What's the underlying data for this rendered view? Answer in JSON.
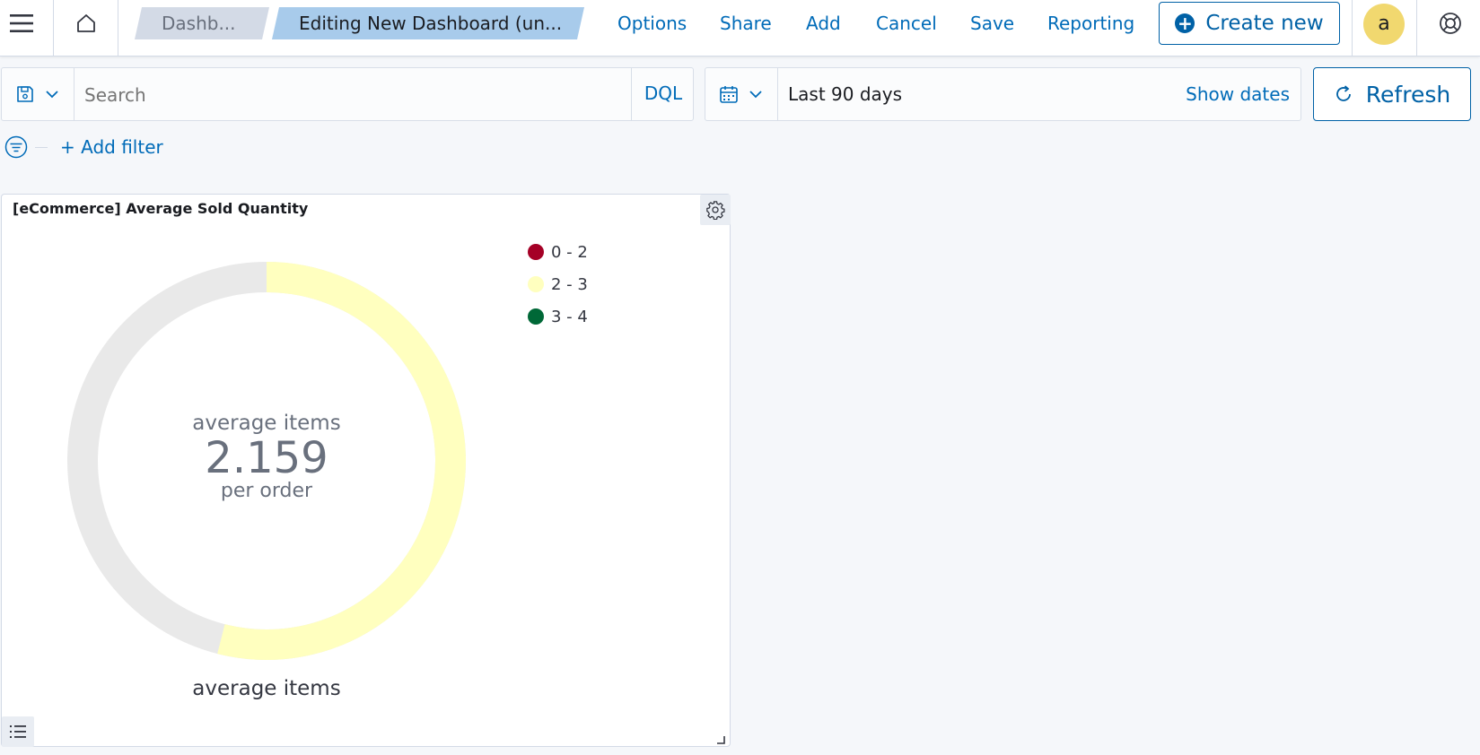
{
  "header": {
    "breadcrumbs": [
      "Dashb...",
      "Editing New Dashboard (un..."
    ],
    "nav": {
      "options": "Options",
      "share": "Share",
      "add": "Add",
      "cancel": "Cancel",
      "save": "Save",
      "reporting": "Reporting"
    },
    "create_new": "Create new",
    "avatar_initial": "a"
  },
  "query": {
    "search_placeholder": "Search",
    "language": "DQL",
    "time_range": "Last 90 days",
    "show_dates": "Show dates",
    "refresh": "Refresh",
    "add_filter": "+ Add filter"
  },
  "panel": {
    "title": "[eCommerce] Average Sold Quantity",
    "gauge_label_top": "average items",
    "gauge_value": "2.159",
    "gauge_label_bottom": "per order",
    "gauge_caption": "average items"
  },
  "chart_data": {
    "type": "gauge",
    "value": 2.159,
    "range": [
      0,
      4
    ],
    "legend": [
      {
        "label": "0 - 2",
        "color": "#a50026"
      },
      {
        "label": "2 - 3",
        "color": "#ffffbf"
      },
      {
        "label": "3 - 4",
        "color": "#006837"
      }
    ]
  },
  "colors": {
    "accent": "#006bb8",
    "gauge_fill": "#ffffbf",
    "gauge_track": "#e9e9e9"
  }
}
